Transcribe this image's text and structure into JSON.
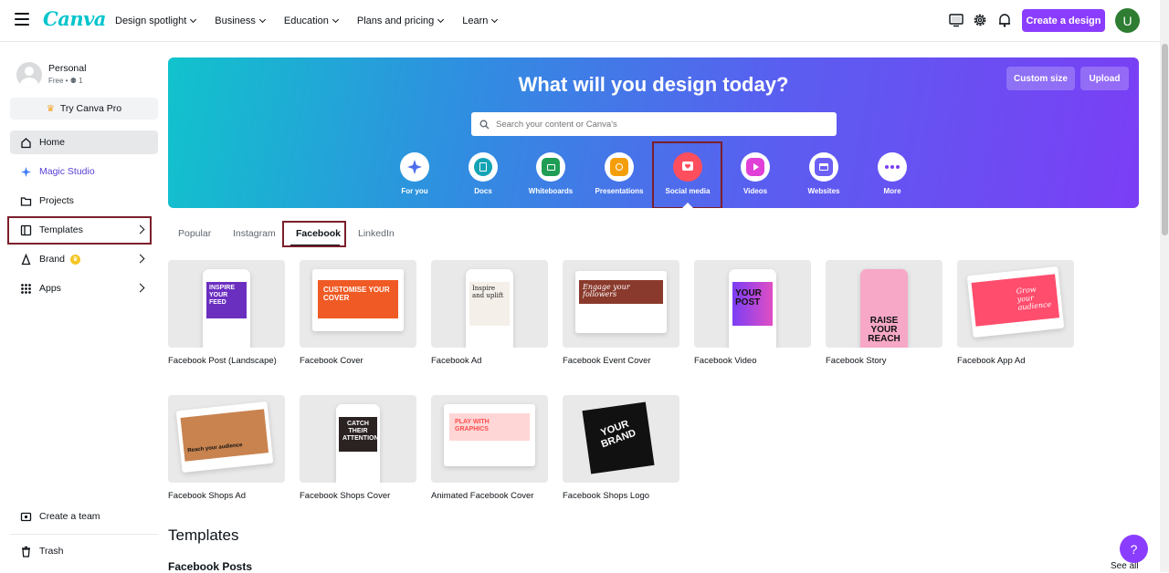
{
  "header": {
    "logo": "Canva",
    "nav": [
      "Design spotlight",
      "Business",
      "Education",
      "Plans and pricing",
      "Learn"
    ],
    "create_label": "Create a design",
    "avatar_initial": "U"
  },
  "sidebar": {
    "profile_name": "Personal",
    "profile_sub": "Free • ⚉ 1",
    "try_pro": "Try Canva Pro",
    "items": [
      {
        "label": "Home"
      },
      {
        "label": "Magic Studio"
      },
      {
        "label": "Projects"
      },
      {
        "label": "Templates"
      },
      {
        "label": "Brand"
      },
      {
        "label": "Apps"
      }
    ],
    "create_team": "Create a team",
    "trash": "Trash"
  },
  "hero": {
    "title": "What will you design today?",
    "custom_size": "Custom size",
    "upload": "Upload",
    "search_placeholder": "Search your content or Canva's",
    "categories": [
      "For you",
      "Docs",
      "Whiteboards",
      "Presentations",
      "Social media",
      "Videos",
      "Websites",
      "More"
    ],
    "selected_category": "Social media"
  },
  "tabs": [
    "Popular",
    "Instagram",
    "Facebook",
    "LinkedIn"
  ],
  "selected_tab": "Facebook",
  "cards": [
    "Facebook Post (Landscape)",
    "Facebook Cover",
    "Facebook Ad",
    "Facebook Event Cover",
    "Facebook Video",
    "Facebook Story",
    "Facebook App Ad",
    "Facebook Shops Ad",
    "Facebook Shops Cover",
    "Animated Facebook Cover",
    "Facebook Shops Logo"
  ],
  "thumb_text": {
    "inspire": "INSPIRE YOUR FEED",
    "customise": "CUSTOMISE YOUR COVER",
    "inspire_uplift": "Inspire and uplift",
    "engage": "Engage your followers",
    "your_post": "YOUR POST",
    "raise": "RAISE YOUR REACH",
    "grow": "Grow your audience",
    "reach": "Reach your audience",
    "catch": "CATCH THEIR ATTENTION",
    "play": "PLAY WITH GRAPHICS",
    "brand": "YOUR BRAND"
  },
  "section_title": "Templates",
  "sub_title": "Facebook Posts",
  "see_all": "See all",
  "help": "?",
  "colors": {
    "accent": "#8b3dff",
    "highlight": "#7b1f2a"
  }
}
